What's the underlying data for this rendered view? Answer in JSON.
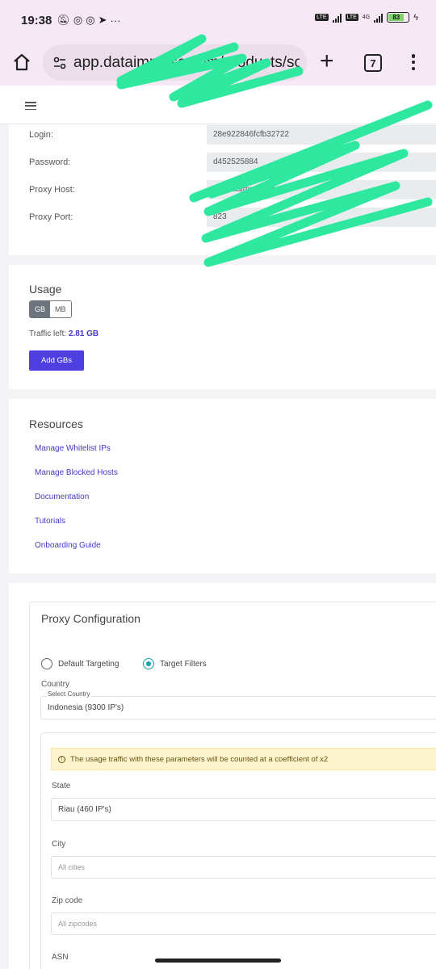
{
  "status_bar": {
    "time": "19:38",
    "more": "···",
    "network": "4G",
    "battery": "83"
  },
  "browser": {
    "url": "app.dataimpulse.com/products/soc",
    "tab_count": "7"
  },
  "credentials": {
    "login_label": "Login:",
    "login_value": "28e922846fcfb32722",
    "password_label": "Password:",
    "password_value": "d452525884",
    "host_label": "Proxy Host:",
    "host_value": "gw.dataimpulse.com",
    "port_label": "Proxy Port:",
    "port_value": "823"
  },
  "usage": {
    "title": "Usage",
    "unit_gb": "GB",
    "unit_mb": "MB",
    "traffic_label": "Traffic left:",
    "traffic_value": "2.81 GB",
    "add_button": "Add GBs"
  },
  "resources": {
    "title": "Resources",
    "links": [
      "Manage Whitelist IPs",
      "Manage Blocked Hosts",
      "Documentation",
      "Tutorials",
      "Onboarding Guide"
    ]
  },
  "proxy_config": {
    "title": "Proxy Configuration",
    "option_default": "Default Targeting",
    "option_target": "Target Filters",
    "country_label": "Country",
    "country_float_label": "Select Country",
    "country_value": "Indonesia (9300 IP's)",
    "warning": "The usage traffic with these parameters will be counted at a coefficient of x2",
    "state_label": "State",
    "state_value": "Riau (460 IP's)",
    "city_label": "City",
    "city_placeholder": "All cities",
    "zip_label": "Zip code",
    "zip_placeholder": "All zipcodes",
    "asn_label": "ASN"
  },
  "colors": {
    "accent": "#4f3fe0",
    "link": "#4539c9",
    "radio_selected": "#1ba0b0",
    "scribble": "#2ee8a0"
  }
}
